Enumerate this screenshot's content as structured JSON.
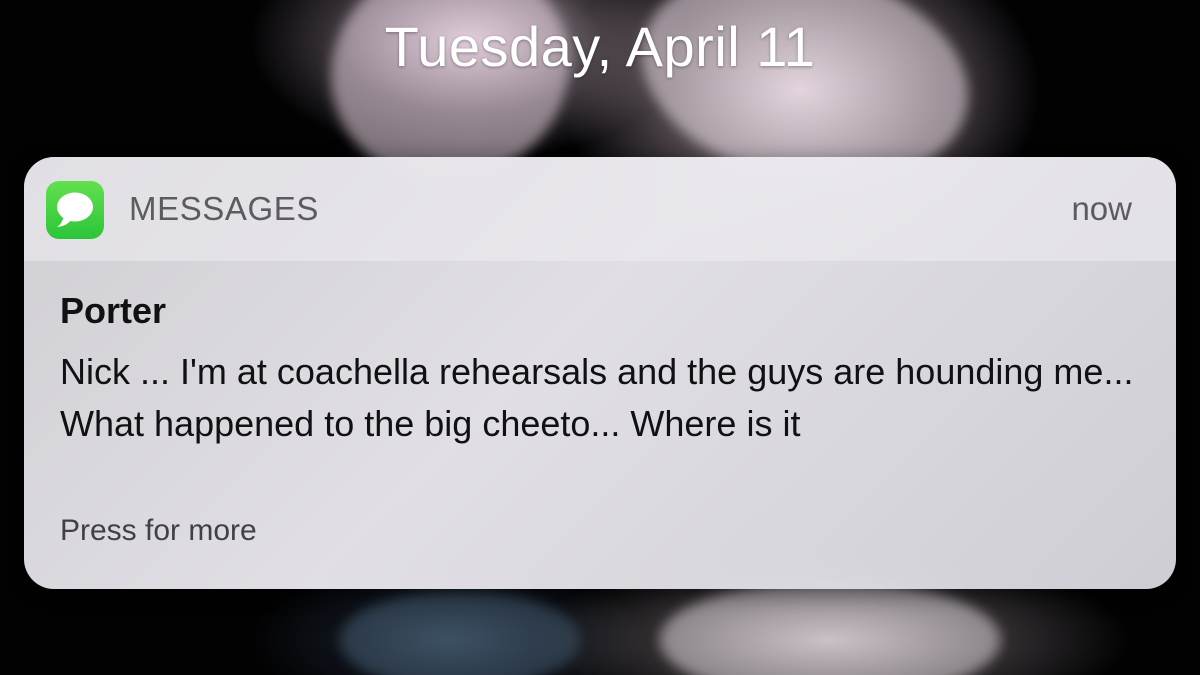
{
  "lockscreen": {
    "date": "Tuesday, April 11"
  },
  "notification": {
    "app_icon": "messages-icon",
    "app_name": "MESSAGES",
    "time": "now",
    "sender": "Porter",
    "body": "Nick ... I'm at coachella rehearsals and the guys are hounding me... What happened to the big cheeto... Where is it",
    "action_hint": "Press for more"
  },
  "colors": {
    "messages_green": "#4cd964",
    "banner_background": "#e2e1e6",
    "secondary_text": "#5b5b60",
    "primary_text": "#111114"
  }
}
